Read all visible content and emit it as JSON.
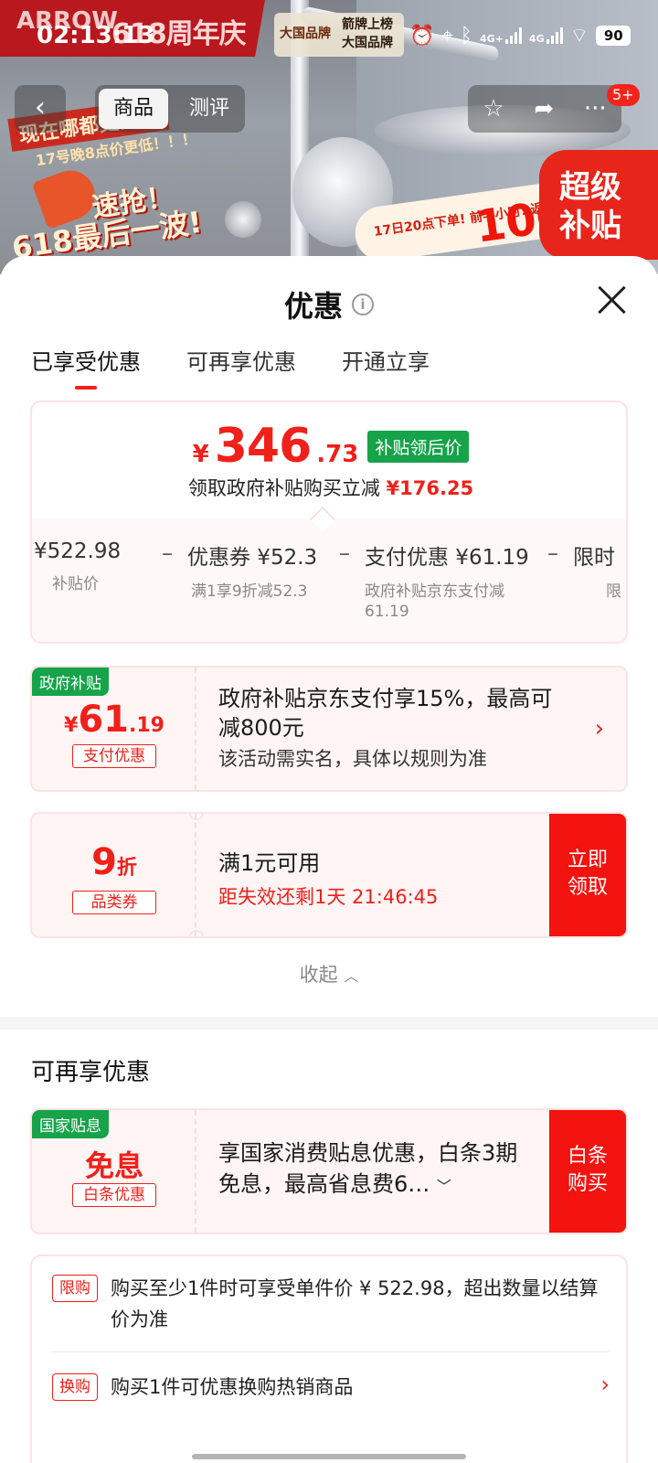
{
  "status_bar": {
    "time": "02:13:13",
    "tag_logo": "大国品牌",
    "tag_line1": "箭牌上榜",
    "tag_line2": "大国品牌",
    "signal1": "4G+",
    "signal2": "4G",
    "battery": "90"
  },
  "hero": {
    "brand": "ARROW",
    "anniversary": "618周年庆",
    "promo_line1": "现在哪都更实惠",
    "promo_line2": "17号晚8点价更低！！！",
    "promo_line3": "速抢！",
    "promo_line4": "618最后一波!",
    "ribbon_text": "17日20点下单! 前半小时! 返",
    "ribbon_big": "100",
    "super_badge": "超级补贴"
  },
  "nav": {
    "back": "‹",
    "tab_product": "商品",
    "tab_review": "测评",
    "badge": "5+"
  },
  "sheet": {
    "title": "优惠",
    "tabs": [
      "已享受优惠",
      "可再享优惠",
      "开通立享"
    ]
  },
  "price_card": {
    "symbol": "¥",
    "price_int": "346",
    "price_dec": ".73",
    "tag": "补贴领后价",
    "subtitle_prefix": "领取政府补贴购买立减",
    "subtitle_amount": "¥176.25",
    "breakdown": [
      {
        "value": "¥522.98",
        "label": "补贴价"
      },
      {
        "value": "优惠券 ¥52.3",
        "label": "满1享9折减52.3"
      },
      {
        "value": "支付优惠 ¥61.19",
        "label": "政府补贴京东支付减 61.19"
      },
      {
        "value": "限时",
        "label": "限"
      }
    ],
    "minus": "–"
  },
  "coupon_gov": {
    "corner": "政府补贴",
    "symbol": "¥",
    "amount_int": "61",
    "amount_dec": ".19",
    "kind": "支付优惠",
    "title": "政府补贴京东支付享15%，最高可减800元",
    "desc": "该活动需实名，具体以规则为准",
    "arrow": "›"
  },
  "coupon_cat": {
    "amount": "9",
    "unit": "折",
    "kind": "品类券",
    "title": "满1元可用",
    "expire": "距失效还剩1天 21:46:45",
    "action": "立即领取"
  },
  "collapse": "收起",
  "section2_title": "可再享优惠",
  "coupon_loan": {
    "corner": "国家贴息",
    "amount": "免息",
    "kind": "白条优惠",
    "title": "享国家消费贴息优惠，白条3期免息，最高省息费6…",
    "action": "白条购买"
  },
  "rules": [
    {
      "tag": "限购",
      "text": "购买至少1件时可享受单件价 ¥ 522.98，超出数量以结算价为准"
    },
    {
      "tag": "换购",
      "text": "购买1件可优惠换购热销商品",
      "arrow": "›"
    }
  ],
  "colors": {
    "accent": "#f0201a",
    "green": "#16a34a"
  }
}
